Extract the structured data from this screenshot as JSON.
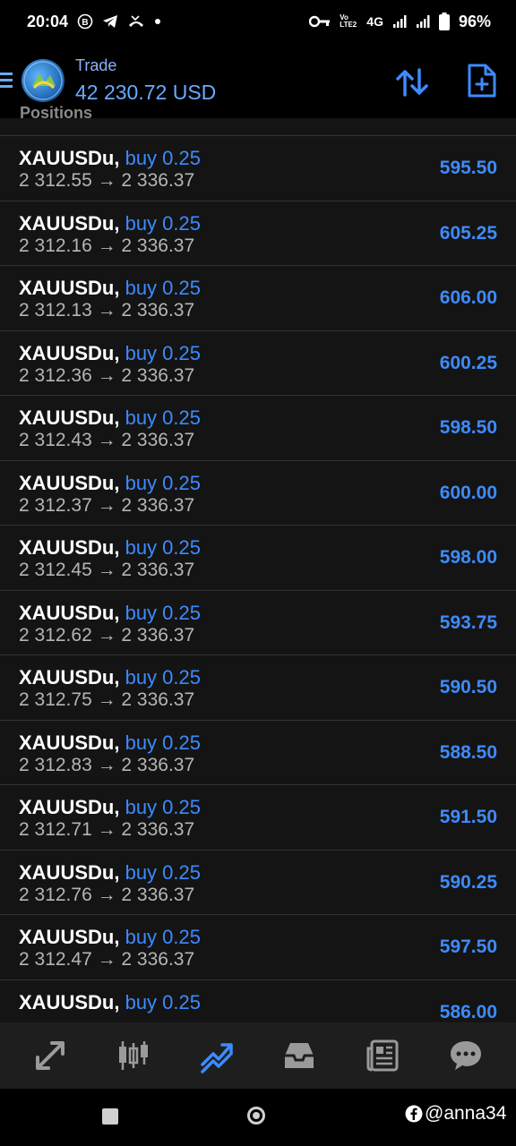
{
  "status_bar": {
    "time": "20:04",
    "battery": "96%",
    "network": "4G",
    "volte": "Vo LTE2"
  },
  "header": {
    "title": "Trade",
    "balance": "42 230.72 USD"
  },
  "section_label": "Positions",
  "positions": [
    {
      "symbol": "XAUUSDu,",
      "side": "buy 0.25",
      "prices": "2 312.55 → 2 336.37",
      "profit": "595.50"
    },
    {
      "symbol": "XAUUSDu,",
      "side": "buy 0.25",
      "prices": "2 312.16 → 2 336.37",
      "profit": "605.25"
    },
    {
      "symbol": "XAUUSDu,",
      "side": "buy 0.25",
      "prices": "2 312.13 → 2 336.37",
      "profit": "606.00"
    },
    {
      "symbol": "XAUUSDu,",
      "side": "buy 0.25",
      "prices": "2 312.36 → 2 336.37",
      "profit": "600.25"
    },
    {
      "symbol": "XAUUSDu,",
      "side": "buy 0.25",
      "prices": "2 312.43 → 2 336.37",
      "profit": "598.50"
    },
    {
      "symbol": "XAUUSDu,",
      "side": "buy 0.25",
      "prices": "2 312.37 → 2 336.37",
      "profit": "600.00"
    },
    {
      "symbol": "XAUUSDu,",
      "side": "buy 0.25",
      "prices": "2 312.45 → 2 336.37",
      "profit": "598.00"
    },
    {
      "symbol": "XAUUSDu,",
      "side": "buy 0.25",
      "prices": "2 312.62 → 2 336.37",
      "profit": "593.75"
    },
    {
      "symbol": "XAUUSDu,",
      "side": "buy 0.25",
      "prices": "2 312.75 → 2 336.37",
      "profit": "590.50"
    },
    {
      "symbol": "XAUUSDu,",
      "side": "buy 0.25",
      "prices": "2 312.83 → 2 336.37",
      "profit": "588.50"
    },
    {
      "symbol": "XAUUSDu,",
      "side": "buy 0.25",
      "prices": "2 312.71 → 2 336.37",
      "profit": "591.50"
    },
    {
      "symbol": "XAUUSDu,",
      "side": "buy 0.25",
      "prices": "2 312.76 → 2 336.37",
      "profit": "590.25"
    },
    {
      "symbol": "XAUUSDu,",
      "side": "buy 0.25",
      "prices": "2 312.47 → 2 336.37",
      "profit": "597.50"
    },
    {
      "symbol": "XAUUSDu,",
      "side": "buy 0.25",
      "prices": "",
      "profit": "586.00"
    }
  ],
  "tabs": [
    {
      "name": "quotes",
      "icon": "quotes-arrows-icon",
      "active": false
    },
    {
      "name": "chart",
      "icon": "candlestick-chart-icon",
      "active": false
    },
    {
      "name": "trade",
      "icon": "trade-line-icon",
      "active": true
    },
    {
      "name": "history",
      "icon": "inbox-history-icon",
      "active": false
    },
    {
      "name": "news",
      "icon": "newspaper-icon",
      "active": false
    },
    {
      "name": "messages",
      "icon": "chat-bubble-icon",
      "active": false
    }
  ],
  "watermark": "@anna34",
  "colors": {
    "accent": "#3d8bfd",
    "background": "#141414",
    "header_bg": "#000000",
    "tabbar_bg": "#1e1e1e",
    "price_text": "#b5b5b5"
  }
}
